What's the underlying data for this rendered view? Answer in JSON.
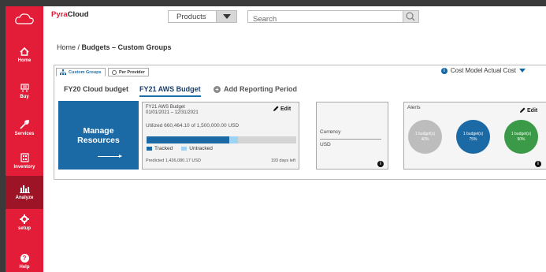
{
  "app": {
    "name_prefix": "Pyra",
    "name_suffix": "Cloud"
  },
  "sidebar": {
    "items": [
      {
        "label": "Home",
        "icon": "home-icon"
      },
      {
        "label": "Buy",
        "icon": "cart-icon"
      },
      {
        "label": "Services",
        "icon": "wrench-icon"
      },
      {
        "label": "Inventory",
        "icon": "inventory-icon"
      },
      {
        "label": "Analyze",
        "icon": "bar-chart-icon",
        "active": true
      },
      {
        "label": "setup",
        "icon": "gear-icon"
      },
      {
        "label": "Help",
        "icon": "help-icon"
      }
    ]
  },
  "header": {
    "products_label": "Products",
    "search_placeholder": "Search"
  },
  "breadcrumb": {
    "home": "Home",
    "separator": " / ",
    "current": "Budgets – Custom Groups"
  },
  "view_tabs": [
    {
      "label": "Custom Groups",
      "active": true
    },
    {
      "label": "Per Provider",
      "active": false
    }
  ],
  "cost_model": {
    "label": "Cost Model Actual Cost"
  },
  "budget_tabs": [
    {
      "label": "FY20 Cloud budget",
      "active": false
    },
    {
      "label": "FY21 AWS Budget",
      "active": true
    }
  ],
  "add_period_label": "Add Reporting Period",
  "manage_resources": {
    "line1": "Manage",
    "line2": "Resources"
  },
  "budget_card": {
    "name": "FY21 AWS Budget",
    "dates": "01/01/2021 – 12/31/2021",
    "edit_label": "Edit",
    "utilized_text": "Utilized 660,464.10 of 1,500,000.00 USD",
    "tracked_fraction": 0.55,
    "untracked_fraction": 0.06,
    "legend_tracked": "Tracked",
    "legend_untracked": "Untracked",
    "predicted": "Predicted 1,436,080.17 USD",
    "days_left": "193 days left"
  },
  "currency_card": {
    "label": "Currency",
    "value": "USD",
    "info": "i"
  },
  "alerts_card": {
    "title": "Alerts",
    "edit_label": "Edit",
    "info": "i",
    "alerts": [
      {
        "count": "1 budget(s)",
        "pct": "40%",
        "color": "#bdbdbd"
      },
      {
        "count": "1 budget(s)",
        "pct": "75%",
        "color": "#1b6aa6"
      },
      {
        "count": "1 budget(s)",
        "pct": "90%",
        "color": "#3a9a48"
      }
    ]
  },
  "colors": {
    "brand": "#e31d37",
    "sidebar_active": "#9c1426",
    "primary_blue": "#1b6aa6",
    "light_blue": "#9dd3f3"
  }
}
